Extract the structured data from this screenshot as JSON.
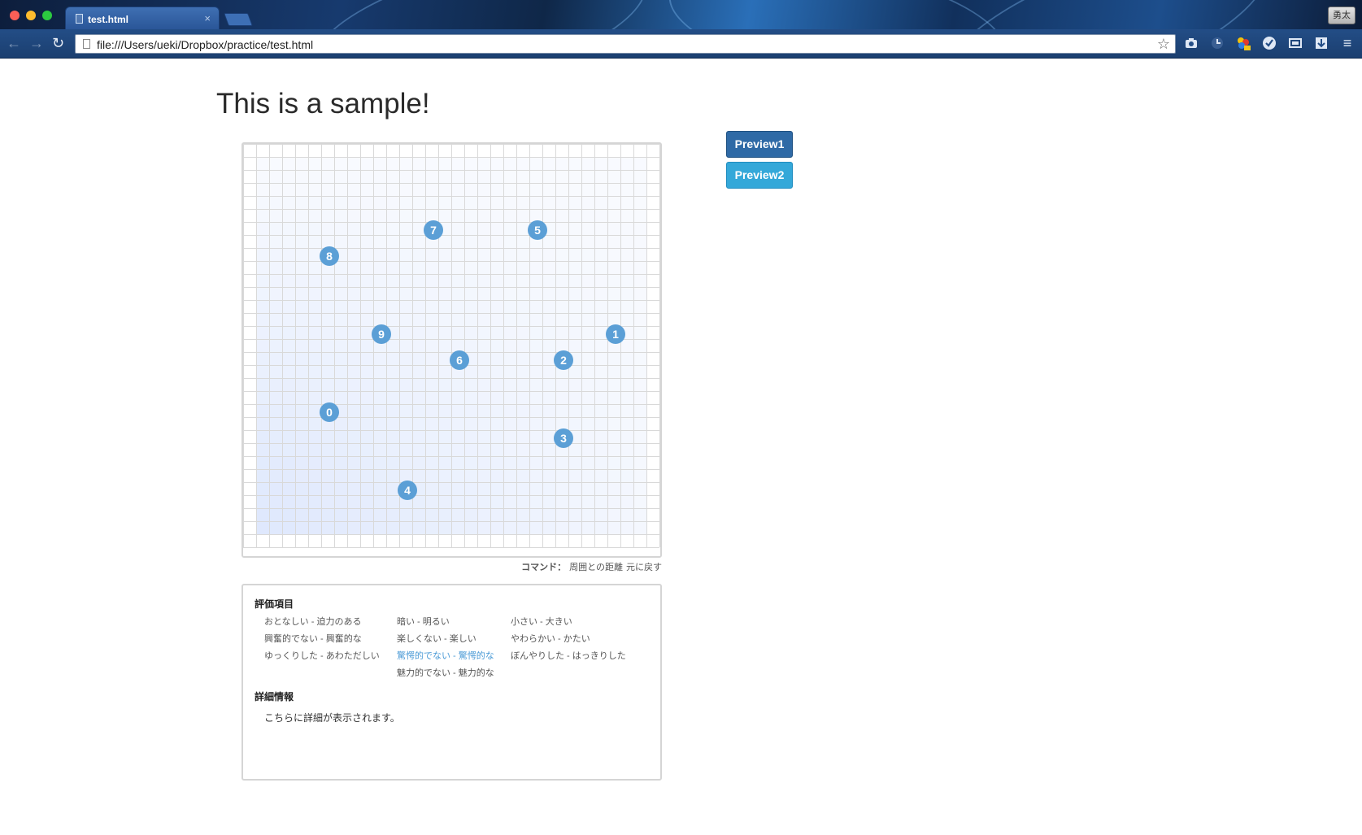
{
  "browser": {
    "tab_title": "test.html",
    "tab_close": "×",
    "profile_name": "勇太",
    "url": "file:///Users/ueki/Dropbox/practice/test.html",
    "back": "←",
    "forward": "→",
    "reload": "↻",
    "star": "☆",
    "menu": "≡"
  },
  "page": {
    "title": "This is a sample!"
  },
  "buttons": {
    "preview1": "Preview1",
    "preview2": "Preview2"
  },
  "grid": {
    "markers": [
      {
        "label": "0",
        "col": 6,
        "row": 20
      },
      {
        "label": "1",
        "col": 28,
        "row": 14
      },
      {
        "label": "2",
        "col": 24,
        "row": 16
      },
      {
        "label": "3",
        "col": 24,
        "row": 22
      },
      {
        "label": "4",
        "col": 12,
        "row": 26
      },
      {
        "label": "5",
        "col": 22,
        "row": 6
      },
      {
        "label": "6",
        "col": 16,
        "row": 16
      },
      {
        "label": "7",
        "col": 14,
        "row": 6
      },
      {
        "label": "8",
        "col": 6,
        "row": 8
      },
      {
        "label": "9",
        "col": 10,
        "row": 14
      }
    ],
    "marker_color": "#5b9fd6",
    "heat_color": "#c8d8fb"
  },
  "commands": {
    "label": "コマンド：",
    "items": [
      "周囲との距離",
      "元に戻す"
    ]
  },
  "evaluation": {
    "title": "評価項目",
    "columns": [
      [
        "おとなしい - 迫力のある",
        "興奮的でない - 興奮的な",
        "ゆっくりした - あわただしい"
      ],
      [
        "暗い - 明るい",
        "楽しくない - 楽しい",
        "驚愕的でない - 驚愕的な",
        "魅力的でない - 魅力的な"
      ],
      [
        "小さい - 大きい",
        "やわらかい - かたい",
        "ぼんやりした - はっきりした"
      ]
    ],
    "active": "驚愕的でない - 驚愕的な"
  },
  "details": {
    "title": "詳細情報",
    "text": "こちらに詳細が表示されます。"
  }
}
